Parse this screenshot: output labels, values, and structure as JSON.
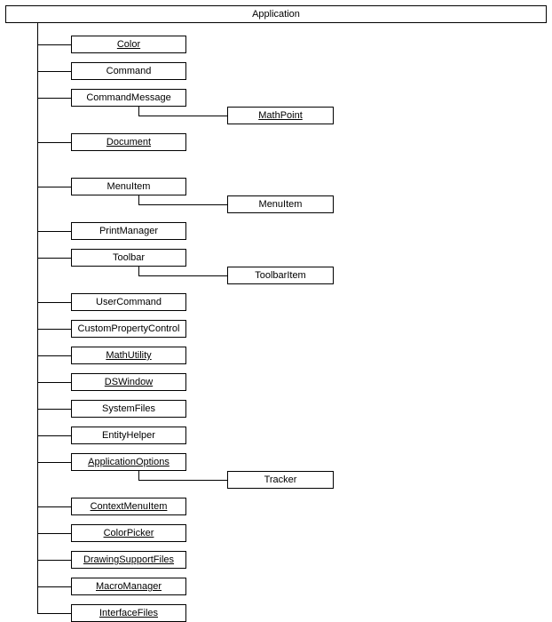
{
  "root": {
    "label": "Application",
    "underline": false
  },
  "children": [
    {
      "key": "color",
      "label": "Color",
      "underline": true
    },
    {
      "key": "command",
      "label": "Command",
      "underline": false
    },
    {
      "key": "commandmessage",
      "label": "CommandMessage",
      "underline": false,
      "sub": {
        "key": "mathpoint",
        "label": "MathPoint",
        "underline": true
      }
    },
    {
      "key": "document",
      "label": "Document",
      "underline": true,
      "gapAfter": 20
    },
    {
      "key": "menuitem",
      "label": "MenuItem",
      "underline": false,
      "sub": {
        "key": "menuitem2",
        "label": "MenuItem",
        "underline": false
      }
    },
    {
      "key": "printmanager",
      "label": "PrintManager",
      "underline": false
    },
    {
      "key": "toolbar",
      "label": "Toolbar",
      "underline": false,
      "sub": {
        "key": "toolbaritem",
        "label": "ToolbarItem",
        "underline": false
      }
    },
    {
      "key": "usercommand",
      "label": "UserCommand",
      "underline": false
    },
    {
      "key": "customproperty",
      "label": "CustomPropertyControl",
      "underline": false
    },
    {
      "key": "mathutility",
      "label": "MathUtility",
      "underline": true
    },
    {
      "key": "dswindow",
      "label": "DSWindow",
      "underline": true
    },
    {
      "key": "systemfiles",
      "label": "SystemFiles",
      "underline": false
    },
    {
      "key": "entityhelper",
      "label": "EntityHelper",
      "underline": false
    },
    {
      "key": "appoptions",
      "label": "ApplicationOptions",
      "underline": true,
      "sub": {
        "key": "tracker",
        "label": "Tracker",
        "underline": false
      }
    },
    {
      "key": "contextmenuitem",
      "label": "ContextMenuItem",
      "underline": true
    },
    {
      "key": "colorpicker",
      "label": "ColorPicker",
      "underline": true
    },
    {
      "key": "drawingsupport",
      "label": "DrawingSupportFiles",
      "underline": true
    },
    {
      "key": "macromanager",
      "label": "MacroManager",
      "underline": true
    },
    {
      "key": "interfacefiles",
      "label": "InterfaceFiles",
      "underline": true
    }
  ],
  "layout": {
    "rootX": 6,
    "rootY": 6,
    "rootW": 610,
    "trunkX": 42,
    "childLeft": 80,
    "childW": 130,
    "startY": 40,
    "stepY": 30,
    "gapBase": 10,
    "subLeft": 256,
    "subW": 120,
    "subOffset": 20,
    "subTrunkX": 156
  }
}
